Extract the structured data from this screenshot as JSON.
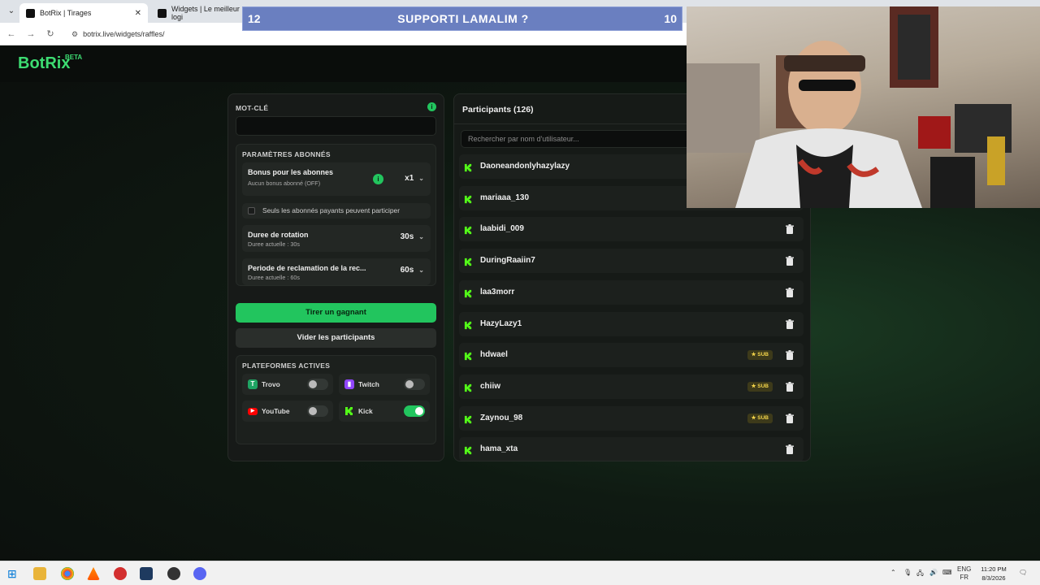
{
  "browser": {
    "tabs": [
      {
        "title": "BotRix | Tirages"
      },
      {
        "title": "Widgets | Le meilleur logi"
      }
    ],
    "url": "botrix.live/widgets/raffles/"
  },
  "stream_banner": {
    "left_number": "12",
    "text": "SUPPORTI LAMALIM ?",
    "right_number": "10"
  },
  "app": {
    "logo": "BotRix",
    "beta": "BETA",
    "keyword": {
      "label": "MOT-CLÉ",
      "value": ""
    },
    "subscriber_params": {
      "title": "PARAMÈTRES ABONNÉS",
      "bonus": {
        "label": "Bonus pour les abonnes",
        "subtitle": "Aucun bonus abonné (OFF)",
        "value": "x1"
      },
      "paid_only": {
        "label": "Seuls les abonnés payants peuvent participer",
        "checked": false
      },
      "rotation": {
        "label": "Duree de rotation",
        "subtitle": "Duree actuelle : 30s",
        "value": "30s"
      },
      "claim": {
        "label": "Periode de reclamation de la rec...",
        "subtitle": "Duree actuelle : 60s",
        "value": "60s"
      }
    },
    "draw_button": "Tirer un gagnant",
    "clear_button": "Vider les participants",
    "platforms": {
      "title": "PLATEFORMES ACTIVES",
      "items": [
        {
          "name": "Trovo",
          "enabled": false,
          "color": "#1fa463"
        },
        {
          "name": "Twitch",
          "enabled": false,
          "color": "#9146ff"
        },
        {
          "name": "YouTube",
          "enabled": false,
          "color": "#ff0000"
        },
        {
          "name": "Kick",
          "enabled": true,
          "color": "#53fc18"
        }
      ]
    },
    "participants": {
      "title": "Participants (126)",
      "search_placeholder": "Rechercher par nom d'utilisateur...",
      "sub_label": "SUB",
      "list": [
        {
          "name": "Daoneandonlyhazylazy",
          "sub": false
        },
        {
          "name": "mariaaa_130",
          "sub": false
        },
        {
          "name": "laabidi_009",
          "sub": false
        },
        {
          "name": "DuringRaaiin7",
          "sub": false
        },
        {
          "name": "laa3morr",
          "sub": false
        },
        {
          "name": "HazyLazy1",
          "sub": false
        },
        {
          "name": "hdwael",
          "sub": true
        },
        {
          "name": "chiiw",
          "sub": true
        },
        {
          "name": "Zaynou_98",
          "sub": true
        },
        {
          "name": "hama_xta",
          "sub": false
        }
      ]
    }
  },
  "taskbar": {
    "lang_top": "ENG",
    "lang_bottom": "FR",
    "time": "11:20 PM",
    "date": "8/3/2026"
  },
  "colors": {
    "accent": "#22c55e",
    "kick_green": "#53fc18",
    "sub_badge": "#f2d34a"
  }
}
